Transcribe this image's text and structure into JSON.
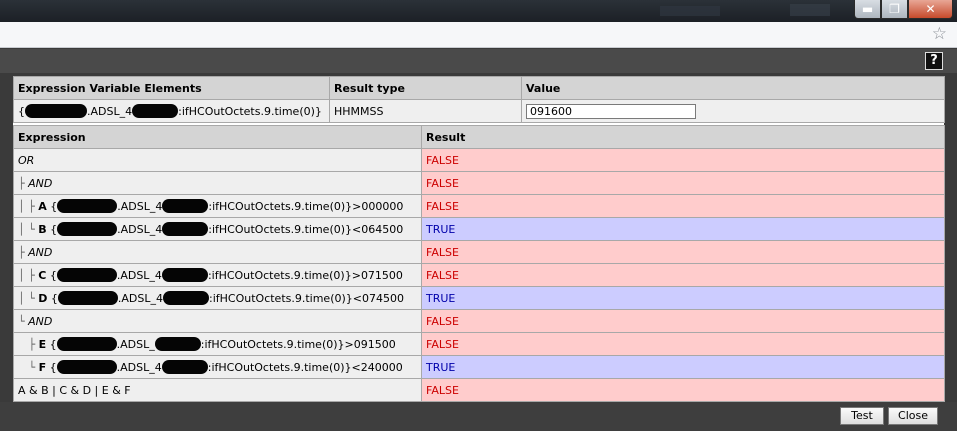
{
  "vars_table": {
    "headers": [
      "Expression Variable Elements",
      "Result type",
      "Value"
    ],
    "row": {
      "prefix": "{",
      "mid": ".ADSL_4",
      "suffix": ":ifHCOutOctets.9.time(0)}",
      "result_type": "HHMMSS",
      "value": "091600"
    }
  },
  "expr_table": {
    "headers": [
      "Expression",
      "Result"
    ],
    "rows": [
      {
        "tree": "",
        "label": "OR",
        "result": "FALSE"
      },
      {
        "tree": "├ ",
        "label": "AND",
        "result": "FALSE"
      },
      {
        "tree": "│ ├ ",
        "label": "A",
        "expr_pre": "{",
        "expr_mid": ".ADSL_4",
        "expr_post": ":ifHCOutOctets.9.time(0)}>000000",
        "result": "FALSE"
      },
      {
        "tree": "│ └ ",
        "label": "B",
        "expr_pre": "{",
        "expr_mid": ".ADSL_4",
        "expr_post": ":ifHCOutOctets.9.time(0)}<064500",
        "result": "TRUE"
      },
      {
        "tree": "├ ",
        "label": "AND",
        "result": "FALSE"
      },
      {
        "tree": "│ ├ ",
        "label": "C",
        "expr_pre": "{",
        "expr_mid": ".ADSL_4",
        "expr_post": ":ifHCOutOctets.9.time(0)}>071500",
        "result": "FALSE"
      },
      {
        "tree": "│ └ ",
        "label": "D",
        "expr_pre": "{",
        "expr_mid": ".ADSL_4",
        "expr_post": ":ifHCOutOctets.9.time(0)}<074500",
        "result": "TRUE"
      },
      {
        "tree": "└ ",
        "label": "AND",
        "result": "FALSE"
      },
      {
        "tree": "   ├ ",
        "label": "E",
        "expr_pre": "{",
        "expr_mid": ".ADSL_",
        "expr_post": ":ifHCOutOctets.9.time(0)}>091500",
        "result": "FALSE"
      },
      {
        "tree": "   └ ",
        "label": "F",
        "expr_pre": "{",
        "expr_mid": ".ADSL_4",
        "expr_post": ":ifHCOutOctets.9.time(0)}<240000",
        "result": "TRUE"
      },
      {
        "tree": "",
        "label": "A & B | C & D | E & F",
        "result": "FALSE"
      }
    ]
  },
  "footer": {
    "test_label": "Test",
    "close_label": "Close"
  },
  "help_label": "?",
  "colors": {
    "false_bg": "#ffcccc",
    "false_fg": "#cc0000",
    "true_bg": "#ccccff",
    "true_fg": "#0000aa"
  },
  "icons": {
    "bookmark": "star-icon",
    "help": "help-icon",
    "minimize": "minimize-icon",
    "maximize": "restore-icon",
    "close": "close-icon"
  }
}
